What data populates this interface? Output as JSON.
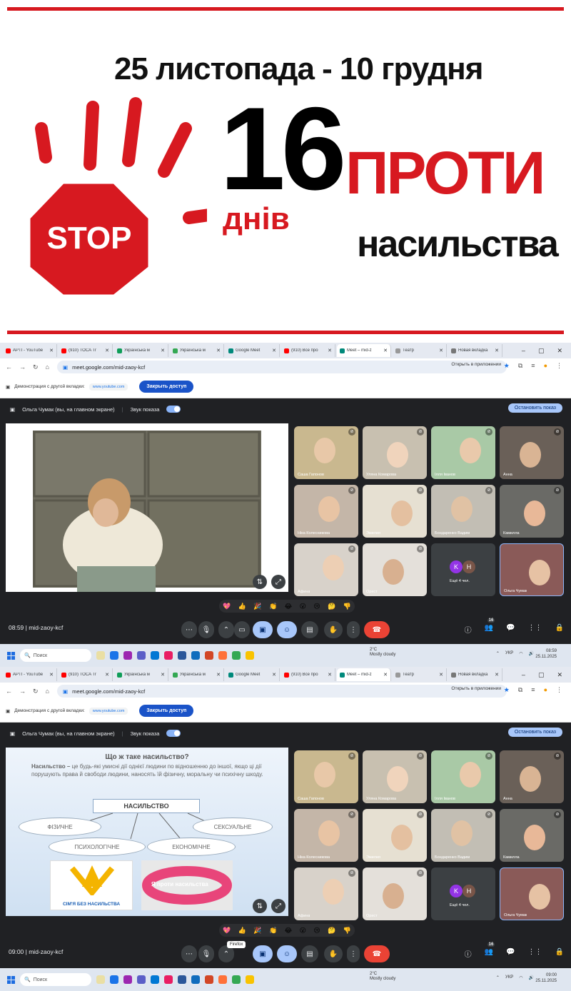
{
  "banner": {
    "dates": "25 листопада - 10 грудня",
    "number": "16",
    "days": "днів",
    "against": "ПРОТИ",
    "violence": "насильства",
    "stop": "STOP"
  },
  "screens": [
    {
      "tabs": [
        {
          "label": "APTI - YouTube",
          "color": "#ff0000"
        },
        {
          "label": "(910) TOCA Tr",
          "color": "#ff0000"
        },
        {
          "label": "Українська м",
          "color": "#0f9d58"
        },
        {
          "label": "Українська м",
          "color": "#34a853"
        },
        {
          "label": "Google Meet",
          "color": "#00897b"
        },
        {
          "label": "(910) Все про",
          "color": "#ff0000"
        },
        {
          "label": "Meet – mid-z",
          "color": "#00897b",
          "active": true
        },
        {
          "label": "Театр",
          "color": "#999999"
        },
        {
          "label": "Новая вкладка",
          "color": "#777777"
        }
      ],
      "url": "meet.google.com/mid-zaoy-kcf",
      "open_in_app": "Открыть в приложении",
      "share_text": "Демонстрация с другой вкладки:",
      "share_site": "www.youtube.com",
      "share_stop": "Закрыть доступ",
      "presenter": "Ольга Чумак (вы, на главном экране)",
      "sound": "Звук показа",
      "stop_show": "Остановить показ",
      "time": "08:59",
      "meeting_id": "mid-zaoy-kcf",
      "participants_count": "16",
      "more_people": "Ещё 4 чел.",
      "weather_temp": "2°C",
      "weather_desc": "Mostly cloudy",
      "lang": "УКР",
      "tb_time": "08:59",
      "tb_date": "25.11.2025",
      "search": "Поиск"
    },
    {
      "tabs": [
        {
          "label": "APTI - YouTube",
          "color": "#ff0000"
        },
        {
          "label": "(910) TOCA Tr",
          "color": "#ff0000"
        },
        {
          "label": "Українська м",
          "color": "#0f9d58"
        },
        {
          "label": "Українська м",
          "color": "#34a853"
        },
        {
          "label": "Google Meet",
          "color": "#00897b"
        },
        {
          "label": "(910) Все про",
          "color": "#ff0000"
        },
        {
          "label": "Meet – mid-z",
          "color": "#00897b",
          "active": true
        },
        {
          "label": "Театр",
          "color": "#999999"
        },
        {
          "label": "Новая вкладка",
          "color": "#777777"
        }
      ],
      "url": "meet.google.com/mid-zaoy-kcf",
      "open_in_app": "Открыть в приложении",
      "share_text": "Демонстрация с другой вкладки:",
      "share_site": "www.youtube.com",
      "share_stop": "Закрыть доступ",
      "presenter": "Ольга Чумак (вы, на главном экране)",
      "sound": "Звук показа",
      "stop_show": "Остановить показ",
      "time": "09:00",
      "meeting_id": "mid-zaoy-kcf",
      "participants_count": "16",
      "more_people": "Ещё 4 чел.",
      "weather_temp": "2°C",
      "weather_desc": "Mostly cloudy",
      "lang": "УКР",
      "tb_time": "09:00",
      "tb_date": "25.11.2025",
      "search": "Поиск",
      "tooltip": "Firefox"
    }
  ],
  "participants": [
    "Саша Гапонов",
    "Уляна Комарова",
    "Ілля Іванов",
    "Анна",
    "Ніка Колесникова",
    "Эмилия",
    "Бондаренко Вадим",
    "Камилла",
    "Афина",
    "Орест",
    "",
    "Ольга Чумак"
  ],
  "slide": {
    "title": "Що ж таке насильство?",
    "term": "Насильство –",
    "text": " це будь-які умисні дії однієї людини по відношенню до іншої, якщо ці дії порушують права й свободи людини, наносять їй фізичну, моральну чи психічну шкоду.",
    "center": "НАСИЛЬСТВО",
    "types": [
      "ФІЗИЧНЕ",
      "ПСИХОЛОГІЧНЕ",
      "ЕКОНОМІЧНЕ",
      "СЕКСУАЛЬНЕ"
    ],
    "logo": "СІМ'Я БЕЗ НАСИЛЬСТВА",
    "band": "Я проти насильства"
  },
  "emojis": [
    "💖",
    "👍",
    "🎉",
    "👏",
    "😂",
    "😮",
    "😢",
    "🤔",
    "👎"
  ],
  "avatars": [
    {
      "letter": "K",
      "color": "#9334e6"
    },
    {
      "letter": "H",
      "color": "#795548"
    }
  ]
}
